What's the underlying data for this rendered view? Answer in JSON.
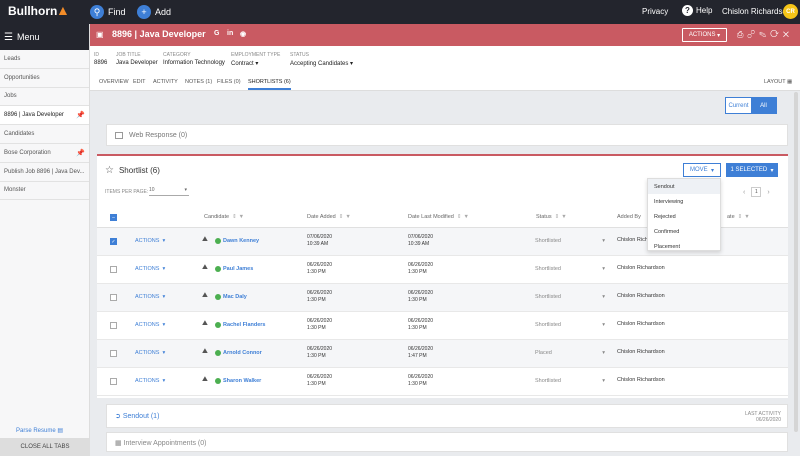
{
  "topbar": {
    "logo": "Bullhorn",
    "find_label": "Find",
    "add_label": "Add",
    "privacy": "Privacy",
    "help": "Help",
    "user_name": "Chislon Richardson",
    "avatar_initials": "CR"
  },
  "sidebar": {
    "menu_label": "Menu",
    "items": [
      {
        "label": "Leads"
      },
      {
        "label": "Opportunities"
      },
      {
        "label": "Jobs"
      },
      {
        "label": "8896 | Java Developer"
      },
      {
        "label": "Candidates"
      },
      {
        "label": "Bose Corporation"
      },
      {
        "label": "Publish Job 8896 | Java Dev..."
      },
      {
        "label": "Monster"
      }
    ],
    "parse_resume": "Parse Resume",
    "close_all_tabs": "CLOSE ALL TABS"
  },
  "record": {
    "id": "8896",
    "title": "Java Developer",
    "actions_label": "ACTIONS",
    "meta": {
      "id_label": "ID",
      "id_value": "8896",
      "job_title_label": "JOB TITLE",
      "job_title_value": "Java Developer",
      "category_label": "CATEGORY",
      "category_value": "Information Technology",
      "employment_label": "EMPLOYMENT TYPE",
      "employment_value": "Contract",
      "status_label": "STATUS",
      "status_value": "Accepting Candidates"
    },
    "tabs": [
      "OVERVIEW",
      "EDIT",
      "ACTIVITY",
      "NOTES (1)",
      "FILES (0)",
      "SHORTLISTS (6)"
    ],
    "layout_label": "LAYOUT"
  },
  "toggle": {
    "current": "Current",
    "all": "All"
  },
  "web_response": "Web Response (0)",
  "shortlist": {
    "title": "Shortlist (6)",
    "move_label": "MOVE",
    "selected_label": "1 SELECTED",
    "items_per_page_label": "ITEMS PER PAGE:",
    "items_per_page_value": "10",
    "page": "1",
    "columns": [
      "Candidate",
      "Date Added",
      "Date Last Modified",
      "Status",
      "Added By",
      "ate"
    ],
    "action_label": "ACTIONS",
    "rows": [
      {
        "name": "Dawn Kenney",
        "added_date": "07/06/2020",
        "added_time": "10:39 AM",
        "mod_date": "07/06/2020",
        "mod_time": "10:39 AM",
        "status": "Shortlisted",
        "added_by": "Chislon Richardson",
        "checked": true
      },
      {
        "name": "Paul James",
        "added_date": "06/26/2020",
        "added_time": "1:30 PM",
        "mod_date": "06/26/2020",
        "mod_time": "1:30 PM",
        "status": "Shortlisted",
        "added_by": "Chislon Richardson",
        "checked": false
      },
      {
        "name": "Mac Daly",
        "added_date": "06/26/2020",
        "added_time": "1:30 PM",
        "mod_date": "06/26/2020",
        "mod_time": "1:30 PM",
        "status": "Shortlisted",
        "added_by": "Chislon Richardson",
        "checked": false
      },
      {
        "name": "Rachel Flanders",
        "added_date": "06/26/2020",
        "added_time": "1:30 PM",
        "mod_date": "06/26/2020",
        "mod_time": "1:30 PM",
        "status": "Shortlisted",
        "added_by": "Chislon Richardson",
        "checked": false
      },
      {
        "name": "Arnold Connor",
        "added_date": "06/26/2020",
        "added_time": "1:30 PM",
        "mod_date": "06/26/2020",
        "mod_time": "1:47 PM",
        "status": "Placed",
        "added_by": "Chislon Richardson",
        "checked": false
      },
      {
        "name": "Sharon Walker",
        "added_date": "06/26/2020",
        "added_time": "1:30 PM",
        "mod_date": "06/26/2020",
        "mod_time": "1:30 PM",
        "status": "Shortlisted",
        "added_by": "Chislon Richardson",
        "checked": false
      }
    ]
  },
  "move_menu": [
    "Sendout",
    "Interviewing",
    "Rejected",
    "Confirmed",
    "Placement"
  ],
  "sendout": {
    "label": "Sendout (1)",
    "last_activity_label": "LAST ACTIVITY",
    "last_activity_value": "06/26/2020"
  },
  "interview": {
    "label": "Interview Appointments (0)"
  }
}
